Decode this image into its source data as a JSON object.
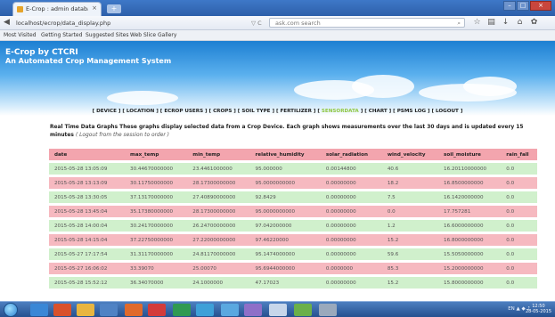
{
  "browser": {
    "tab_title": "E-Crop : admin database",
    "tab_close": "×",
    "new_tab": "+",
    "window_controls": {
      "minimize": "–",
      "maximize": "□",
      "close": "×"
    },
    "url": "localhost/ecrop/data_display.php",
    "search_placeholder": "ask.com search",
    "bookmarks": [
      "Most Visited",
      "Getting Started",
      "Suggested Sites",
      "Web Slice Gallery"
    ]
  },
  "site": {
    "title": "E-Crop by CTCRI",
    "subtitle": "An Automated Crop Management System"
  },
  "nav": {
    "links": [
      "DEVICE",
      "LOCATION",
      "ECROP USERS",
      "CROPS",
      "SOIL TYPE",
      "FERTILIZER",
      "SENSORDATA",
      "CHART",
      "PSMS LOG",
      "LOGOUT"
    ],
    "active": "SENSORDATA"
  },
  "description": {
    "text": "Real Time Data Graphs These graphs display selected data from a Crop Device. Each graph shows measurements over the last 30 days and is updated every 15 minutes",
    "note": "( Logout from the session to order )"
  },
  "table": {
    "columns": [
      "date",
      "max_temp",
      "min_temp",
      "relative_humidity",
      "solar_radiation",
      "wind_velocity",
      "soil_moisture",
      "rain_fall"
    ],
    "rows": [
      [
        "2015-05-28 13:05:09",
        "30.44670000000",
        "23.4461000000",
        "95.000000",
        "0.00144800",
        "40.6",
        "16.20110000000",
        "0.0"
      ],
      [
        "2015-05-28 13:13:09",
        "30.11750000000",
        "28.17300000000",
        "95.0000000000",
        "0.00000000",
        "18.2",
        "16.8500000000",
        "0.0"
      ],
      [
        "2015-05-28 13:30:05",
        "37.13170000000",
        "27.40890000000",
        "92.8429",
        "0.00000000",
        "7.5",
        "16.1420000000",
        "0.0"
      ],
      [
        "2015-05-28 13:45:04",
        "35.17380000000",
        "28.17300000000",
        "95.0000000000",
        "0.00000000",
        "0.0",
        "17.757281",
        "0.0"
      ],
      [
        "2015-05-28 14:00:04",
        "30.24170000000",
        "26.24700000000",
        "97.042000000",
        "0.00000000",
        "1.2",
        "16.6000000000",
        "0.0"
      ],
      [
        "2015-05-28 14:15:04",
        "37.22750000000",
        "27.22000000000",
        "97.46220000",
        "0.00000000",
        "15.2",
        "16.8000000000",
        "0.0"
      ],
      [
        "2015-05-27 17:17:54",
        "31.31170000000",
        "24.81170000000",
        "95.1474000000",
        "0.00000000",
        "59.6",
        "15.5050000000",
        "0.0"
      ],
      [
        "2015-05-27 16:06:02",
        "33.39070",
        "25.00070",
        "95.6944000000",
        "0.0000000",
        "85.3",
        "15.2000000000",
        "0.0"
      ],
      [
        "2015-05-28 15:52:12",
        "36.34070000",
        "24.1000000",
        "47.17023",
        "0.00000000",
        "15.2",
        "15.8000000000",
        "0.0"
      ]
    ]
  },
  "taskbar": {
    "tray_text": "EN ▲ ◆ ♪",
    "time": "12:50",
    "date": "28-05-2015"
  }
}
